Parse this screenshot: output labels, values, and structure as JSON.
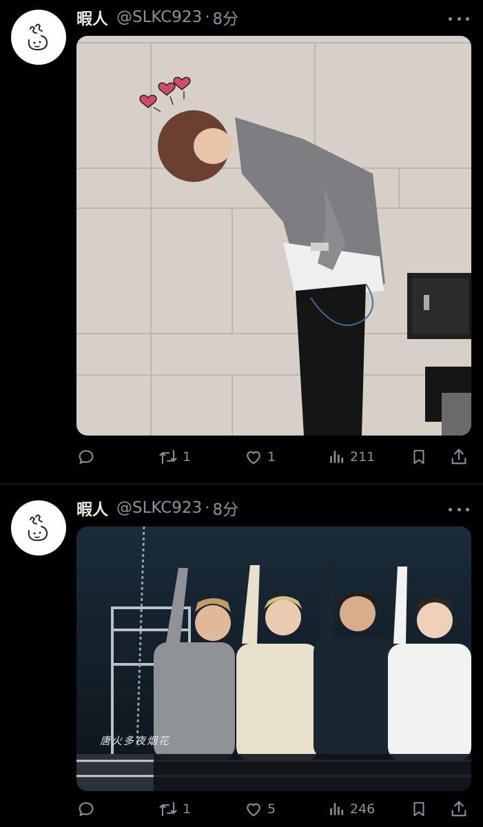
{
  "tweets": [
    {
      "author_name": "暇人",
      "handle": "@SLKC923",
      "separator": "·",
      "time": "8分",
      "avatar_icon": "hand-drawn-doodle-icon",
      "media": {
        "description": "photo",
        "caption": ""
      },
      "actions": {
        "reply_count": "",
        "retweet_count": "1",
        "like_count": "1",
        "view_count": "211"
      }
    },
    {
      "author_name": "暇人",
      "handle": "@SLKC923",
      "separator": "·",
      "time": "8分",
      "avatar_icon": "hand-drawn-doodle-icon",
      "media": {
        "description": "photo",
        "caption": "唐火多夜烟花"
      },
      "actions": {
        "reply_count": "",
        "retweet_count": "1",
        "like_count": "5",
        "view_count": "246"
      }
    }
  ],
  "colors": {
    "background": "#000000",
    "text_primary": "#e7e9ea",
    "text_secondary": "#8b949e",
    "divider": "#2f3336"
  }
}
